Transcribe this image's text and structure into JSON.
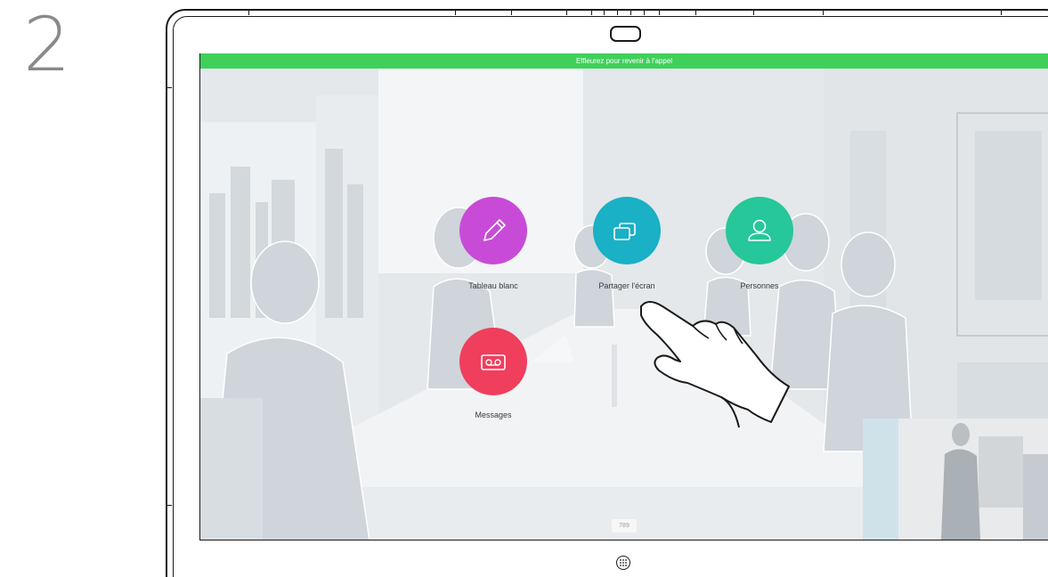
{
  "step": {
    "number": "2"
  },
  "banner": {
    "text": "Effleurez pour revenir à l'appel",
    "color": "#3fd05a"
  },
  "apps": [
    {
      "label": "Tableau blanc",
      "icon": "pencil-icon",
      "color": "#c84bd7"
    },
    {
      "label": "Partager l'écran",
      "icon": "share-screen-icon",
      "color": "#1ab0c6"
    },
    {
      "label": "Personnes",
      "icon": "person-icon",
      "color": "#26c79a"
    },
    {
      "label": "Messages",
      "icon": "voicemail-icon",
      "color": "#f03e5d"
    }
  ],
  "badge": {
    "text": "789"
  },
  "icons": {
    "home": "home-grid-icon",
    "hand": "pointing-hand-icon",
    "camera": "camera-icon"
  }
}
